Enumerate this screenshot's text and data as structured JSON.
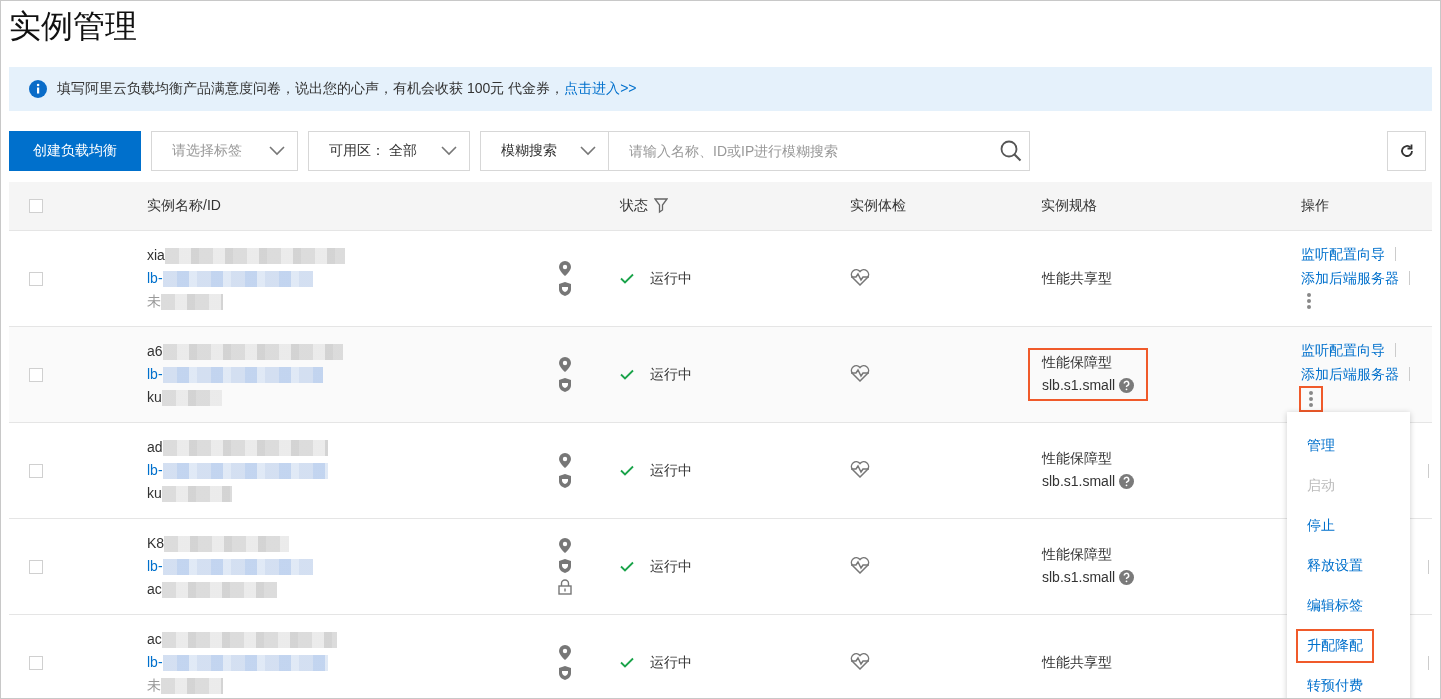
{
  "page_title": "实例管理",
  "notice": {
    "text": "填写阿里云负载均衡产品满意度问卷，说出您的心声，有机会收获 100元 代金券，",
    "link": "点击进入>>"
  },
  "toolbar": {
    "create_button": "创建负载均衡",
    "tag_select": {
      "placeholder": "请选择标签"
    },
    "zone_select": {
      "label": "可用区：",
      "value": "全部"
    },
    "search_type": {
      "value": "模糊搜索"
    },
    "search": {
      "placeholder": "请输入名称、ID或IP进行模糊搜索"
    }
  },
  "table": {
    "header_checked": false,
    "columns": [
      "实例名称/ID",
      "状态",
      "实例体检",
      "实例规格",
      "操作"
    ],
    "rows": [
      {
        "checked": false,
        "hovered": false,
        "name": "xia",
        "id": "lb-",
        "note": "未",
        "note_muted": true,
        "locked": false,
        "status": "运行中",
        "spec": "性能共享型",
        "spec_highlighted": false,
        "actions": [
          "监听配置向导",
          "添加后端服务器"
        ],
        "more_highlighted": false
      },
      {
        "checked": false,
        "hovered": true,
        "name": "a6",
        "id": "lb-",
        "note": "ku",
        "note_muted": false,
        "locked": false,
        "status": "运行中",
        "spec": "性能保障型",
        "spec_size": "slb.s1.small",
        "spec_highlighted": true,
        "actions": [
          "监听配置向导",
          "添加后端服务器"
        ],
        "more_highlighted": true
      },
      {
        "checked": false,
        "hovered": false,
        "name": "ad",
        "id": "lb-",
        "note": "ku",
        "note_muted": false,
        "locked": false,
        "status": "运行中",
        "spec": "性能保障型",
        "spec_size": "slb.s1.small",
        "spec_highlighted": false
      },
      {
        "checked": false,
        "hovered": false,
        "name": "K8",
        "id": "lb-",
        "note": "ac",
        "note_muted": false,
        "locked": true,
        "status": "运行中",
        "spec": "性能保障型",
        "spec_size": "slb.s1.small",
        "spec_highlighted": false
      },
      {
        "checked": false,
        "hovered": false,
        "name": "ac",
        "id": "lb-",
        "note": "未",
        "note_muted": true,
        "locked": false,
        "status": "运行中",
        "spec": "性能共享型",
        "spec_highlighted": false
      }
    ]
  },
  "menu": {
    "items": [
      {
        "label": "管理",
        "disabled": false,
        "highlighted": false
      },
      {
        "label": "启动",
        "disabled": true,
        "highlighted": false
      },
      {
        "label": "停止",
        "disabled": false,
        "highlighted": false
      },
      {
        "label": "释放设置",
        "disabled": false,
        "highlighted": false
      },
      {
        "label": "编辑标签",
        "disabled": false,
        "highlighted": false
      },
      {
        "label": "升配降配",
        "disabled": false,
        "highlighted": true
      },
      {
        "label": "转预付费",
        "disabled": false,
        "highlighted": false
      }
    ]
  }
}
